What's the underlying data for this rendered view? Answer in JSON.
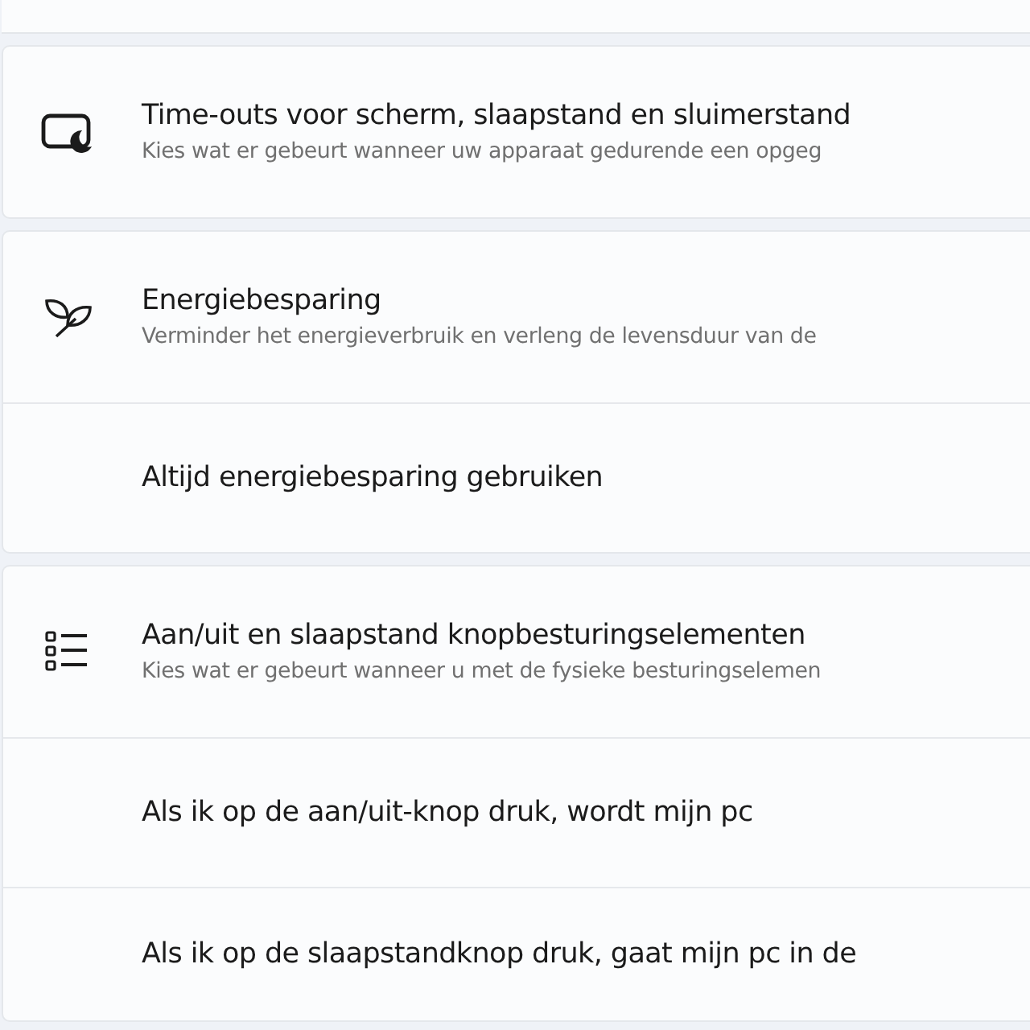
{
  "cards": [
    {
      "rows": [
        {
          "kind": "header",
          "title": "Time-outs voor scherm, slaapstand en sluimerstand",
          "subtitle": "Kies wat er gebeurt wanneer uw apparaat gedurende een opgeg"
        }
      ]
    },
    {
      "rows": [
        {
          "kind": "header",
          "title": "Energiebesparing",
          "subtitle": "Verminder het energieverbruik en verleng de levensduur van de"
        },
        {
          "kind": "setting",
          "title": "Altijd energiebesparing gebruiken"
        }
      ]
    },
    {
      "rows": [
        {
          "kind": "header",
          "title": "Aan/uit en slaapstand knopbesturingselementen",
          "subtitle": "Kies wat er gebeurt wanneer u met de fysieke besturingselemen"
        },
        {
          "kind": "setting",
          "title": "Als ik op de aan/uit-knop druk, wordt mijn pc"
        },
        {
          "kind": "setting",
          "title": "Als ik op de slaapstandknop druk, gaat mijn pc in de"
        }
      ]
    }
  ]
}
